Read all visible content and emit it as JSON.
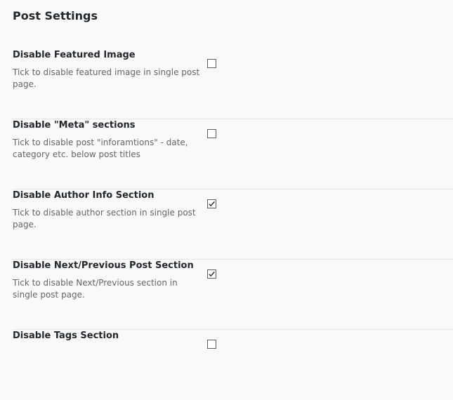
{
  "page": {
    "title": "Post Settings"
  },
  "settings": [
    {
      "label": "Disable Featured Image",
      "description": "Tick to disable featured image in single post page.",
      "checked": false
    },
    {
      "label": "Disable \"Meta\" sections",
      "description": "Tick to disable post \"inforamtions\" - date, category etc. below post titles",
      "checked": false
    },
    {
      "label": "Disable Author Info Section",
      "description": "Tick to disable author section in single post page.",
      "checked": true
    },
    {
      "label": "Disable Next/Previous Post Section",
      "description": "Tick to disable Next/Previous section in single post page.",
      "checked": true
    },
    {
      "label": "Disable Tags Section",
      "description": "",
      "checked": false
    }
  ],
  "colors": {
    "background": "#f9f9f9",
    "text": "#23282d",
    "muted_text": "#666666",
    "divider": "#e5e5e5",
    "checkbox_border": "#555d66"
  }
}
